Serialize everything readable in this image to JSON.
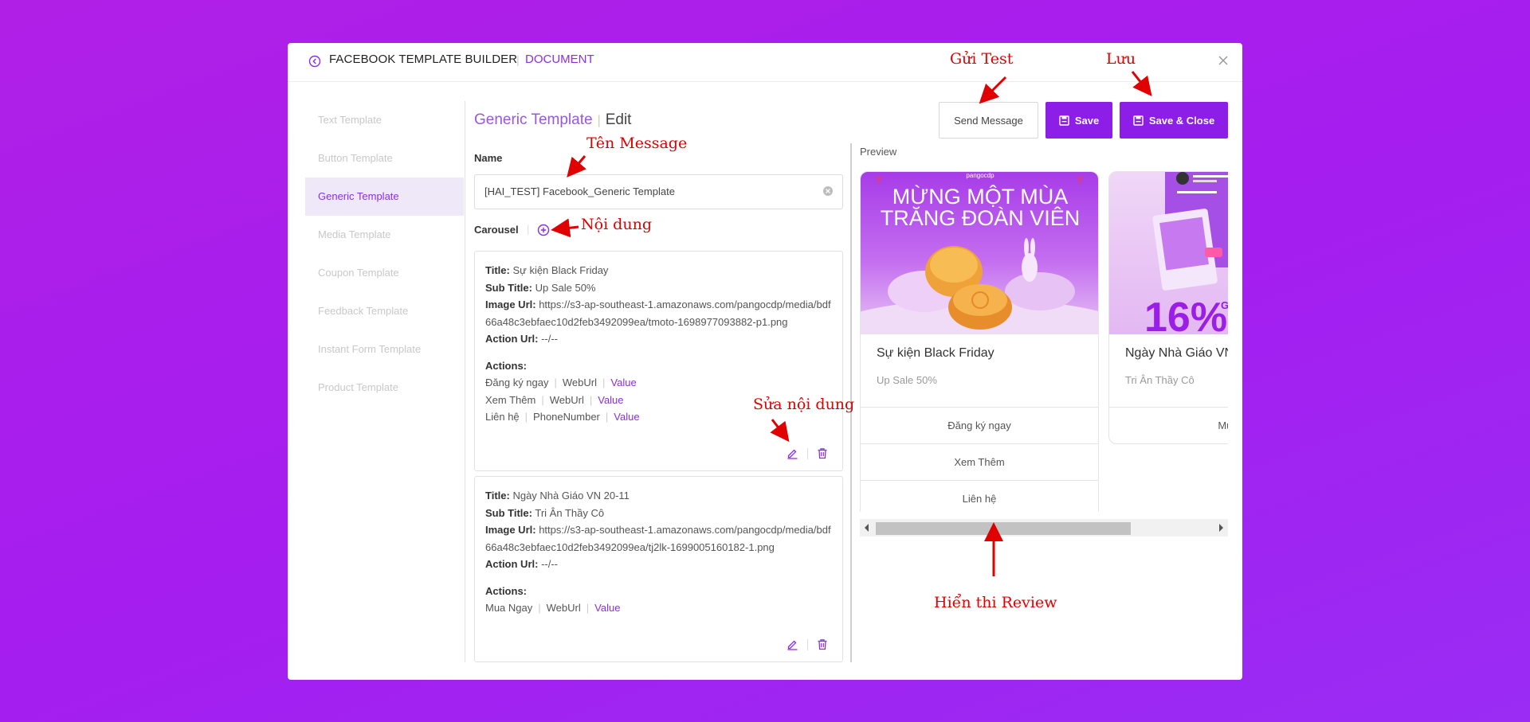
{
  "header": {
    "title": "FACEBOOK TEMPLATE BUILDER",
    "section": "DOCUMENT"
  },
  "sidebar": {
    "items": [
      {
        "label": "Text Template"
      },
      {
        "label": "Button Template"
      },
      {
        "label": "Generic Template",
        "active": true
      },
      {
        "label": "Media Template"
      },
      {
        "label": "Coupon Template"
      },
      {
        "label": "Feedback Template"
      },
      {
        "label": "Instant Form Template"
      },
      {
        "label": "Product Template"
      }
    ]
  },
  "editor": {
    "breadcrumb_link": "Generic Template",
    "breadcrumb_current": "Edit",
    "name_label": "Name",
    "name_value": "[HAI_TEST] Facebook_Generic Template",
    "carousel_label": "Carousel"
  },
  "toolbar": {
    "send_label": "Send Message",
    "save_label": "Save",
    "save_close_label": "Save & Close"
  },
  "cards": [
    {
      "title_key": "Title:",
      "title": "Sự kiện Black Friday",
      "subtitle_key": "Sub Title:",
      "subtitle": "Up Sale 50%",
      "image_key": "Image Url:",
      "image_url": "https://s3-ap-southeast-1.amazonaws.com/pangocdp/media/bdf66a48c3ebfaec10d2feb3492099ea/tmoto-1698977093882-p1.png",
      "action_url_key": "Action Url:",
      "action_url": "--/--",
      "actions_label": "Actions:",
      "actions": [
        {
          "name": "Đăng ký ngay",
          "type": "WebUrl",
          "value": "Value"
        },
        {
          "name": "Xem Thêm",
          "type": "WebUrl",
          "value": "Value"
        },
        {
          "name": "Liên hệ",
          "type": "PhoneNumber",
          "value": "Value"
        }
      ]
    },
    {
      "title_key": "Title:",
      "title": "Ngày Nhà Giáo VN 20-11",
      "subtitle_key": "Sub Title:",
      "subtitle": "Tri Ân Thầy Cô",
      "image_key": "Image Url:",
      "image_url": "https://s3-ap-southeast-1.amazonaws.com/pangocdp/media/bdf66a48c3ebfaec10d2feb3492099ea/tj2lk-1699005160182-1.png",
      "action_url_key": "Action Url:",
      "action_url": "--/--",
      "actions_label": "Actions:",
      "actions": [
        {
          "name": "Mua Ngay",
          "type": "WebUrl",
          "value": "Value"
        }
      ]
    }
  ],
  "preview": {
    "label": "Preview",
    "cards": [
      {
        "banner_brand": "pangocdp",
        "banner_line1": "MỪNG MỘT MÙA",
        "banner_line2": "TRĂNG ĐOÀN VIÊN",
        "title": "Sự kiện Black Friday",
        "subtitle": "Up Sale 50%",
        "buttons": [
          "Đăng ký ngay",
          "Xem Thêm",
          "Liên hệ"
        ]
      },
      {
        "banner_big": "16%",
        "banner_small": "GIẢI",
        "title": "Ngày Nhà Giáo VN",
        "subtitle": "Tri Ân Thầy Cô",
        "buttons": [
          "Mua"
        ]
      }
    ],
    "scroll_position": 0.0
  },
  "annotations": {
    "send_test": "Gửi Test",
    "save": "Lưu",
    "message_name": "Tên Message",
    "content": "Nội dung",
    "edit_content": "Sửa nội dung",
    "review": "Hiển thi Review"
  },
  "colors": {
    "accent": "#8c1ee8",
    "annotation": "#e00000",
    "background": "#a41ef0"
  }
}
